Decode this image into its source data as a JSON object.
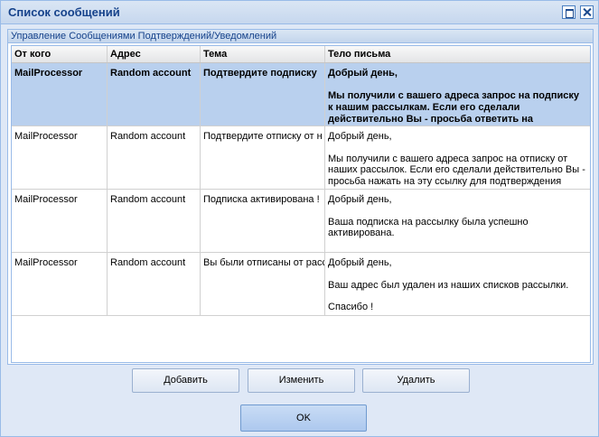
{
  "window": {
    "title": "Список сообщений"
  },
  "panel": {
    "header": "Управление Сообщениями Подтверждений/Уведомлений"
  },
  "grid": {
    "columns": [
      "От кого",
      "Адрес",
      "Тема",
      "Тело письма"
    ],
    "rows": [
      {
        "from": "MailProcessor",
        "address": "Random account",
        "subject": "Подтвердите подписку",
        "body": [
          "Добрый день,",
          "",
          "Мы получили с вашего адреса запрос на подписку к нашим рассылкам. Если его сделали действительно Вы - просьба ответить на"
        ],
        "selected": true
      },
      {
        "from": "MailProcessor",
        "address": "Random account",
        "subject": "Подтвердите отписку от н",
        "body": [
          "Добрый день,",
          "",
          "Мы получили с вашего адреса запрос на отписку от наших рассылок. Если его сделали действительно Вы - просьба нажать на эту ссылку для подтверждения"
        ],
        "selected": false
      },
      {
        "from": "MailProcessor",
        "address": "Random account",
        "subject": "Подписка активирована !",
        "body": [
          "Добрый день,",
          "",
          "Ваша подписка на рассылку была успешно активирована."
        ],
        "selected": false
      },
      {
        "from": "MailProcessor",
        "address": "Random account",
        "subject": "Вы были отписаны от расс",
        "body": [
          "Добрый день,",
          "",
          "Ваш адрес был удален из наших списков рассылки.",
          "",
          "Спасибо !"
        ],
        "selected": false
      }
    ]
  },
  "buttons": {
    "add": "Добавить",
    "edit": "Изменить",
    "delete": "Удалить",
    "ok": "OK"
  }
}
